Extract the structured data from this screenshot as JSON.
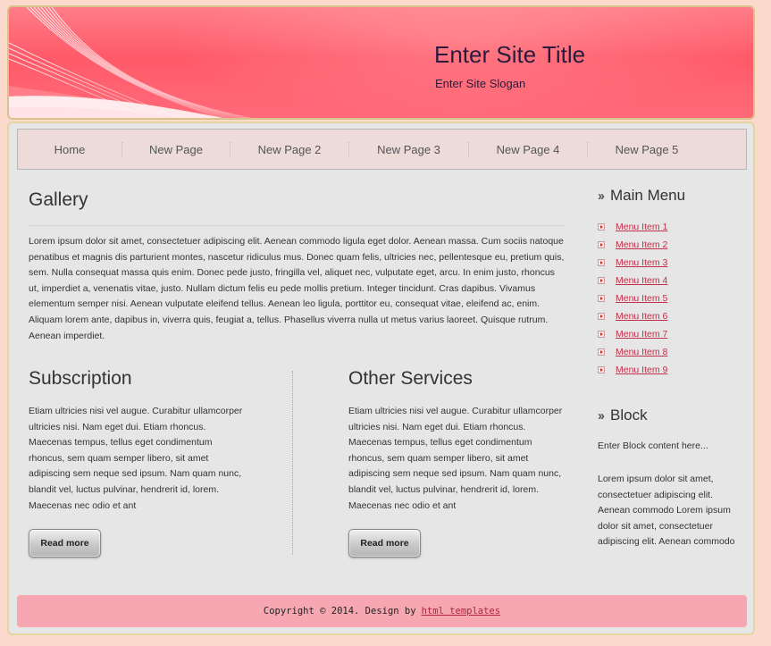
{
  "header": {
    "title": "Enter Site Title",
    "slogan": "Enter Site Slogan"
  },
  "nav": {
    "items": [
      "Home",
      "New Page",
      "New Page 2",
      "New Page 3",
      "New Page 4",
      "New Page 5"
    ]
  },
  "gallery": {
    "title": "Gallery",
    "text": "Lorem ipsum dolor sit amet, consectetuer adipiscing elit. Aenean commodo ligula eget dolor. Aenean massa. Cum sociis natoque penatibus et magnis dis parturient montes, nascetur ridiculus mus. Donec quam felis, ultricies nec, pellentesque eu, pretium quis, sem. Nulla consequat massa quis enim. Donec pede justo, fringilla vel, aliquet nec, vulputate eget, arcu. In enim justo, rhoncus ut, imperdiet a, venenatis vitae, justo. Nullam dictum felis eu pede mollis pretium. Integer tincidunt. Cras dapibus. Vivamus elementum semper nisi. Aenean vulputate eleifend tellus. Aenean leo ligula, porttitor eu, consequat vitae, eleifend ac, enim. Aliquam lorem ante, dapibus in, viverra quis, feugiat a, tellus. Phasellus viverra nulla ut metus varius laoreet. Quisque rutrum. Aenean imperdiet."
  },
  "subscription": {
    "title": "Subscription",
    "text": "Etiam ultricies nisi vel augue. Curabitur ullamcorper ultricies nisi. Nam eget dui. Etiam rhoncus. Maecenas tempus, tellus eget condimentum rhoncus, sem quam semper libero, sit amet adipiscing sem neque sed ipsum. Nam quam nunc, blandit vel, luctus pulvinar, hendrerit id, lorem. Maecenas nec odio et ant",
    "button": "Read more"
  },
  "other_services": {
    "title": "Other Services",
    "text": "Etiam ultricies nisi vel augue. Curabitur ullamcorper ultricies nisi. Nam eget dui. Etiam rhoncus. Maecenas tempus, tellus eget condimentum rhoncus, sem quam semper libero, sit amet adipiscing sem neque sed ipsum. Nam quam nunc, blandit vel, luctus pulvinar, hendrerit id, lorem. Maecenas nec odio et ant",
    "button": "Read more"
  },
  "sidebar": {
    "main_menu_title": "Main Menu",
    "menu_items": [
      "Menu Item 1",
      "Menu Item 2",
      "Menu Item 3",
      "Menu Item 4",
      "Menu Item 5",
      "Menu Item 6",
      "Menu Item 7",
      "Menu Item 8",
      "Menu Item 9"
    ],
    "block_title": "Block",
    "block_intro": "Enter Block content here...",
    "block_text": "Lorem ipsum dolor sit amet, consectetuer adipiscing elit. Aenean commodo Lorem ipsum dolor sit amet, consectetuer adipiscing elit. Aenean commodo"
  },
  "footer": {
    "copyright": "Copyright © 2014. Design by",
    "link": "html templates"
  },
  "colors": {
    "background": "#fcd9cd",
    "header": "#ff5a69",
    "panel": "#e5e6e5",
    "nav": "#ecdbd9",
    "footer": "#f6a7b1",
    "link": "#c0304a"
  }
}
